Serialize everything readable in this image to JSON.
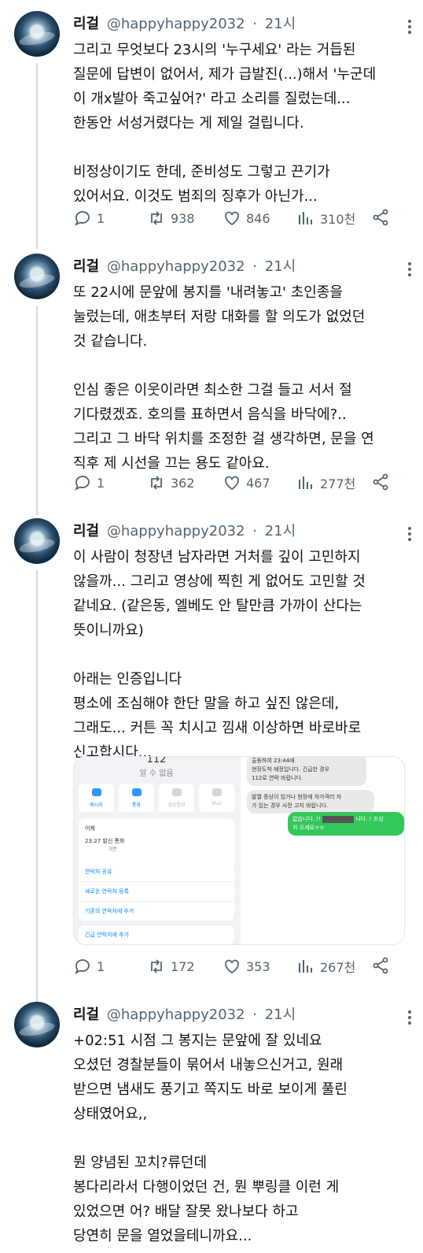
{
  "author": {
    "name": "리걸",
    "handle": "@happyhappy2032",
    "time": "21시",
    "separator": "·"
  },
  "tweets": [
    {
      "body": "그리고 무엇보다 23시의 '누구세요' 라는 거듭된\n질문에 답변이 없어서, 제가 급발진(...)해서 '누군데\n이 개x발아 죽고싶어?' 라고 소리를 질렀는데...\n한동안 서성거렸다는 게 제일 걸립니다.\n\n비정상이기도 한데, 준비성도 그렇고 끈기가\n있어서요. 이것도 범죄의 징후가 아닌가...",
      "replies": "1",
      "retweets": "938",
      "likes": "846",
      "views": "310천"
    },
    {
      "body": "또 22시에 문앞에 봉지를 '내려놓고' 초인종을\n눌렀는데, 애초부터 저랑 대화를 할 의도가 없었던\n것 같습니다.\n\n인심 좋은 이웃이라면 최소한 그걸 들고 서서 절\n기다렸겠죠. 호의를 표하면서 음식을 바닥에?..\n그리고 그 바닥 위치를 조정한 걸 생각하면, 문을 연\n직후 제 시선을 끄는 용도 같아요.",
      "replies": "1",
      "retweets": "362",
      "likes": "467",
      "views": "277천"
    },
    {
      "body": "이 사람이 청장년 남자라면 거처를 깊이 고민하지\n않을까... 그리고 영상에 찍힌 게 없어도 고민할 것\n같네요. (같은동, 엘베도 안 탈만큼 가까이 산다는\n뜻이니까요)\n\n아래는 인증입니다\n평소에 조심해야 한단 말을 하고 싶진 않은데,\n그래도... 커튼 꼭 치시고 낌새 이상하면 바로바로\n신고합시다...",
      "replies": "1",
      "retweets": "172",
      "likes": "353",
      "views": "267천"
    },
    {
      "body": "+02:51 시점 그 봉지는 문앞에 잘 있네요\n오셨던 경찰분들이 묶어서 내놓으신거고, 원래\n받으면 냄새도 풍기고 쪽지도 바로 보이게 풀린\n상태였어요,,\n\n뭔 양념된 꼬치?류던데\n봉다리라서 다행이었던 건, 뭔 뿌링클 이런 게\n있었으면 어? 배달 잘못 왔나보다 하고\n당연히 문을 열었을테니까요..."
    }
  ],
  "media": {
    "call_number": "112",
    "call_status": "알 수 없음",
    "buttons": [
      "메시지",
      "통화",
      "영상통화",
      "Mail"
    ],
    "recent_label": "어제",
    "recent_time": "23:27",
    "recent_type": "발신 통화",
    "recent_duration": "3분",
    "menu": [
      "연락처 공유",
      "새로운 연락처 등록",
      "기존의 연락처에 추가"
    ],
    "emergency": "긴급 연락처에 추가",
    "gray_bubble_1": "출동하여 23:44에\n현장도착 예정입니다. 긴급한 경우\n112로 연락 바랍니다.",
    "gray_bubble_2": "발열 증상이 있거나 현장에 자가격리 자\n가 있는 경우 사전 고지 바랍니다.",
    "green_pre": "없습니다..!!",
    "green_post": "니다..! 조심\n히 오세요ㅠㅠ"
  }
}
